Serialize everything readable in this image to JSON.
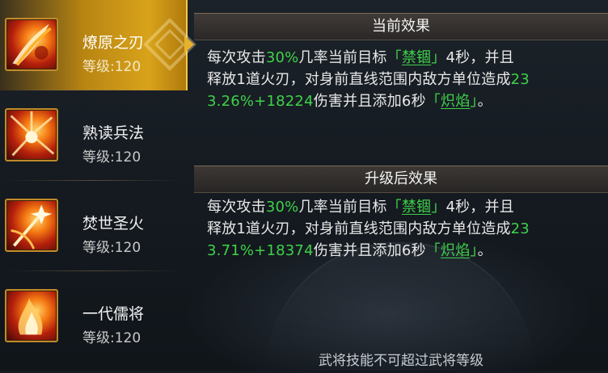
{
  "skills": [
    {
      "name": "燎原之刃",
      "level": "等级:120",
      "icon": "flame-blade-icon",
      "selected": true
    },
    {
      "name": "熟读兵法",
      "level": "等级:120",
      "icon": "fire-burst-icon",
      "selected": false
    },
    {
      "name": "焚世圣火",
      "level": "等级:120",
      "icon": "holy-fire-icon",
      "selected": false
    },
    {
      "name": "一代儒将",
      "level": "等级:120",
      "icon": "scholar-general-icon",
      "selected": false
    }
  ],
  "current_effect": {
    "title": "当前效果",
    "line1": {
      "a": "每次攻击",
      "b": "30%",
      "c": "几率当前目标",
      "d1": "「",
      "d2": "禁锢",
      "d3": "」",
      "e": "4秒，并且"
    },
    "line2": {
      "a": "释放1道火刃，对身前直线范围内敌方单位造成",
      "b": "23"
    },
    "line3": {
      "a": "3.26%+18224",
      "b": "伤害并且添加6秒",
      "c1": "「",
      "c2": "炽焰",
      "c3": "」",
      "d": "。"
    }
  },
  "upgraded_effect": {
    "title": "升级后效果",
    "line1": {
      "a": "每次攻击",
      "b": "30%",
      "c": "几率当前目标",
      "d1": "「",
      "d2": "禁锢",
      "d3": "」",
      "e": "4秒，并且"
    },
    "line2": {
      "a": "释放1道火刃，对身前直线范围内敌方单位造成",
      "b": "23"
    },
    "line3": {
      "a": "3.71%+18374",
      "b": "伤害并且添加6秒",
      "c1": "「",
      "c2": "炽焰",
      "c3": "」",
      "d": "。"
    }
  },
  "footer": "武将技能不可超过武将等级",
  "colors": {
    "highlight": "#3fd14a",
    "selected_gold": "#d9a31b"
  }
}
